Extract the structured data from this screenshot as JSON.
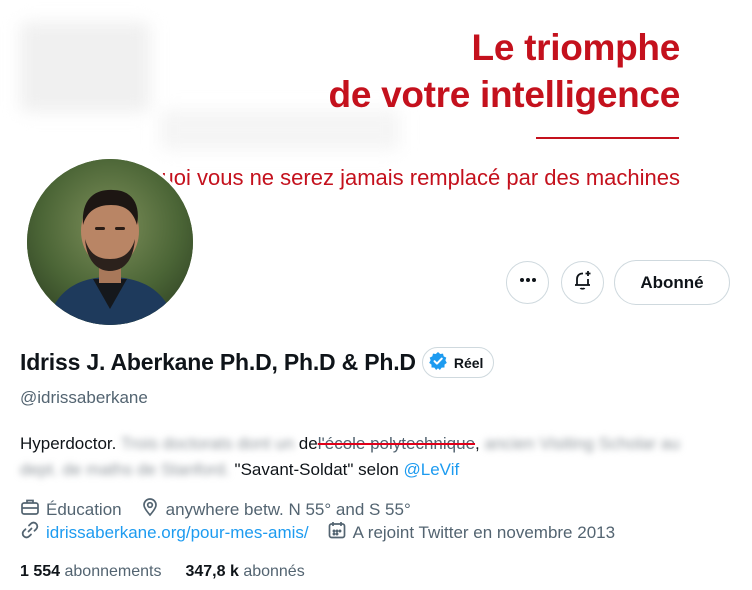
{
  "banner": {
    "title_line1": "Le triomphe",
    "title_line2": "de votre intelligence",
    "subtitle": "Pourquoi vous ne serez jamais remplacé par des machines",
    "brand_color": "#c4111d"
  },
  "actions": {
    "more_icon": "ellipsis-icon",
    "notify_icon": "bell-plus-icon",
    "follow_label": "Abonné"
  },
  "profile": {
    "name": "Idriss J. Aberkane Ph.D, Ph.D & Ph.D",
    "verified_label": "Réel",
    "handle": "@idrissaberkane",
    "bio": {
      "prefix": "Hyperdoctor.",
      "blurred_1": "Trois doctorats dont un",
      "mid": "de",
      "struck": "l'école polytechnique",
      "comma": ",",
      "blurred_2": "ancien Visiting Scholar au dept. de maths de Stanford.",
      "quote": "\"Savant-Soldat\" selon",
      "mention": "@LeVif"
    },
    "category": "Éducation",
    "location": "anywhere betw. N 55° and S 55°",
    "website": "idrissaberkane.org/pour-mes-amis/",
    "joined": "A rejoint Twitter en novembre 2013"
  },
  "stats": {
    "following_count": "1 554",
    "following_label": "abonnements",
    "followers_count": "347,8 k",
    "followers_label": "abonnés"
  },
  "colors": {
    "accent": "#1d9bf0",
    "text": "#0f1419",
    "muted": "#536471"
  }
}
